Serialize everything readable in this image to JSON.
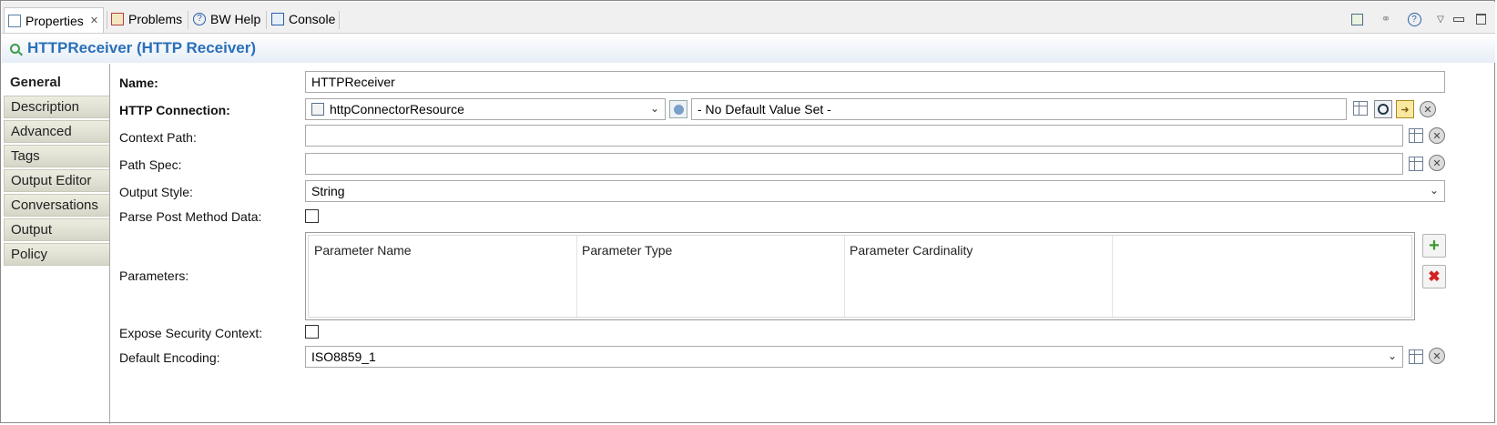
{
  "tabs": [
    {
      "label": "Properties",
      "icon": "properties-icon",
      "active": true,
      "closable": true
    },
    {
      "label": "Problems",
      "icon": "problems-icon"
    },
    {
      "label": "BW Help",
      "icon": "help-icon"
    },
    {
      "label": "Console",
      "icon": "console-icon"
    }
  ],
  "toolbar_icons": [
    "open-editor-icon",
    "pin-icon",
    "help-icon",
    "minimize-icon",
    "maximize-icon"
  ],
  "title": "HTTPReceiver (HTTP Receiver)",
  "side_tabs": [
    "General",
    "Description",
    "Advanced",
    "Tags",
    "Output Editor",
    "Conversations",
    "Output",
    "Policy"
  ],
  "form": {
    "name_label": "Name:",
    "name_value": "HTTPReceiver",
    "http_connection_label": "HTTP Connection:",
    "http_connection_value": "httpConnectorResource",
    "default_value": "- No Default Value Set -",
    "context_path_label": "Context Path:",
    "context_path_value": "",
    "path_spec_label": "Path Spec:",
    "path_spec_value": "",
    "output_style_label": "Output Style:",
    "output_style_value": "String",
    "parse_post_label": "Parse Post Method Data:",
    "parse_post_checked": false,
    "parameters_label": "Parameters:",
    "parameter_columns": [
      "Parameter Name",
      "Parameter Type",
      "Parameter Cardinality"
    ],
    "expose_security_label": "Expose Security Context:",
    "expose_security_checked": false,
    "default_encoding_label": "Default Encoding:",
    "default_encoding_value": "ISO8859_1"
  },
  "colors": {
    "title": "#2a6fb8",
    "add": "#3a9a2a",
    "remove": "#d42020"
  }
}
